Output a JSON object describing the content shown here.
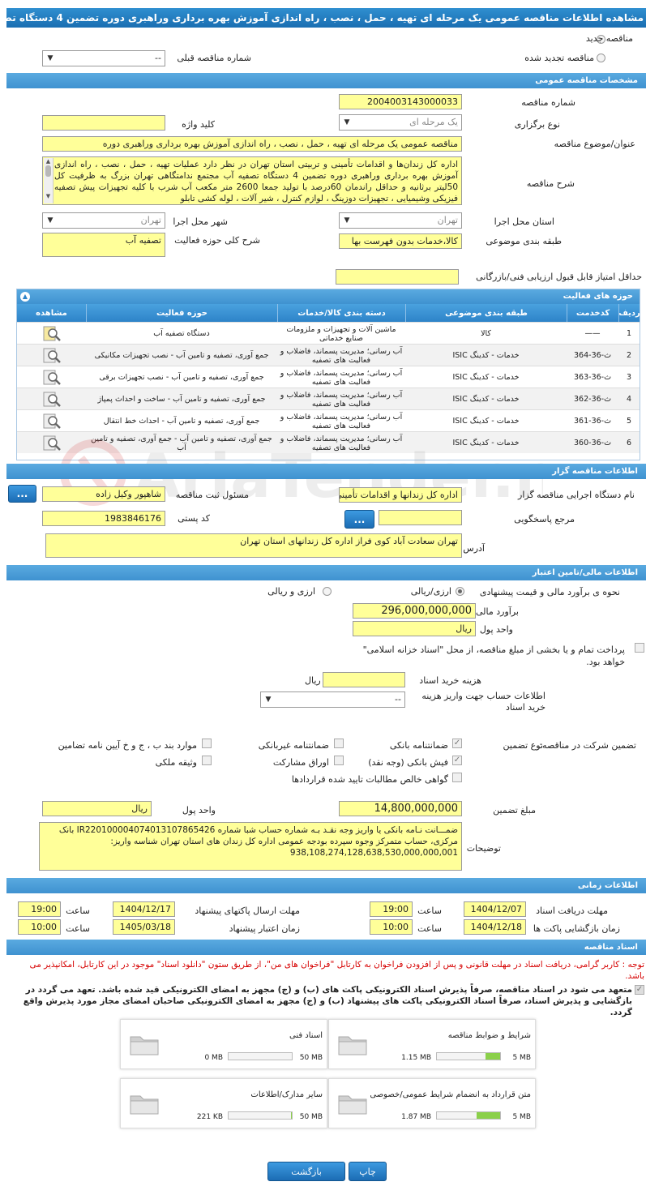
{
  "header": {
    "title": "مشاهده اطلاعات مناقصه عمومی یک مرحله ای تهیه ، حمل ، نصب ، راه اندازی آموزش بهره برداری وراهبری دوره تضمین 4 دستگاه تصفیه آب"
  },
  "top": {
    "new_label": "مناقصه جدید",
    "renew_label": "مناقصه تجدید شده",
    "prev_label": "شماره مناقصه قبلی",
    "prev_value": "--"
  },
  "general": {
    "title": "مشخصات مناقصه عمومی",
    "number_label": "شماره مناقصه",
    "number_value": "2004003143000033",
    "type_label": "نوع برگزاری",
    "type_value": "یک مرحله ای",
    "keyword_label": "کلید واژه",
    "keyword_value": "",
    "subject_label": "عنوان/موضوع مناقصه",
    "subject_value": "مناقصه عمومی یک مرحله ای تهیه ، حمل ، نصب ، راه اندازی آموزش بهره برداری وراهبری دوره",
    "desc_label": "شرح مناقصه",
    "desc_value": "اداره کل زندان‌ها و اقدامات تأمینی و تربیتی استان تهران در نظر دارد عملیات تهیه ، حمل ، نصب ، راه اندازی آموزش بهره برداری وراهبری دوره تضمین 4 دستگاه تصفیه آب مجتمع ندامتگاهی تهران بزرگ به ظرفیت کل 50لیتر برثانیه و حداقل راندمان 60درصد با تولید جمعا 2600 متر مکعب آب شرب با کلیه تجهیزات پیش تصفیه فیزیکی وشیمیایی ، تجهیزات دوزینگ ، لوازم کنترل ، شیر آلات ، لوله کشی تابلو",
    "province_label": "استان محل اجرا",
    "province_value": "تهران",
    "city_label": "شهر محل اجرا",
    "city_value": "تهران",
    "category_label": "طبقه بندی موضوعی",
    "category_value": "کالا،خدمات بدون فهرست بها",
    "activity_label": "شرح کلی حوزه فعالیت",
    "activity_value": "تصفیه آب",
    "minscore_label": "حداقل امتیاز قابل قبول ارزیابی فنی/بازرگانی",
    "minscore_value": ""
  },
  "activities": {
    "title": "حوزه های فعالیت",
    "columns": [
      "ردیف",
      "کدخدمت",
      "طبقه بندی موضوعی",
      "دسته بندی کالا/خدمات",
      "حوزه فعالیت",
      "مشاهده"
    ],
    "rows": [
      {
        "n": "1",
        "code": "——",
        "cat": "کالا",
        "group": "ماشین آلات و تجهیزات و ملزومات صنایع خدماتی",
        "field": "دستگاه تصفیه آب"
      },
      {
        "n": "2",
        "code": "ث-36-364",
        "cat": "خدمات - کدینگ ISIC",
        "group": "آب رسانی؛ مدیریت پسماند، فاضلاب و فعالیت های تصفیه",
        "field": "جمع آوری، تصفیه و تامین آب - نصب تجهیزات مکانیکی"
      },
      {
        "n": "3",
        "code": "ث-36-363",
        "cat": "خدمات - کدینگ ISIC",
        "group": "آب رسانی؛ مدیریت پسماند، فاضلاب و فعالیت های تصفیه",
        "field": "جمع آوری، تصفیه و تامین آب - نصب تجهیزات برقی"
      },
      {
        "n": "4",
        "code": "ث-36-362",
        "cat": "خدمات - کدینگ ISIC",
        "group": "آب رسانی؛ مدیریت پسماند، فاضلاب و فعالیت های تصفیه",
        "field": "جمع آوری، تصفیه و تامین آب - ساخت و احداث پمپاژ"
      },
      {
        "n": "5",
        "code": "ث-36-361",
        "cat": "خدمات - کدینگ ISIC",
        "group": "آب رسانی؛ مدیریت پسماند، فاضلاب و فعالیت های تصفیه",
        "field": "جمع آوری، تصفیه و تامین آب - احداث خط انتقال"
      },
      {
        "n": "6",
        "code": "ث-36-360",
        "cat": "خدمات - کدینگ ISIC",
        "group": "آب رسانی؛ مدیریت پسماند، فاضلاب و فعالیت های تصفیه",
        "field": "جمع آوری، تصفیه و تامین آب - جمع آوری، تصفیه و تامین آب"
      }
    ]
  },
  "organizer": {
    "title": "اطلاعات مناقصه گزار",
    "org_label": "نام دستگاه اجرایی مناقصه گزار",
    "org_value": "اداره کل زندانها و اقدامات تأمینی",
    "resp_label": "مسئول ثبت مناقصه",
    "resp_value": "شاهپور وکیل زاده",
    "dots": "...",
    "ref_label": "مرجع پاسخگویی",
    "ref_value": "",
    "postal_label": "کد پستی",
    "postal_value": "1983846176",
    "address_label": "آدرس",
    "address_value": "تهران سعادت آباد کوی فراز اداره کل زندانهای استان تهران"
  },
  "finance": {
    "title": "اطلاعات مالی/تامین اعتبار",
    "method_label": "نحوه ی برآورد مالی و قیمت پیشنهادی",
    "opt1": "ارزی/ریالی",
    "opt2": "ارزی و ریالی",
    "estimate_label": "برآورد مالی",
    "estimate_value": "296,000,000,000",
    "unit_label": "واحد پول",
    "unit_value": "ریال",
    "treasury_text": "پرداخت تمام و یا بخشی از مبلغ مناقصه، از محل \"اسناد خزانه اسلامی\" خواهد بود.",
    "doccost_label": "هزینه خرید اسناد",
    "doccost_value": "",
    "doccost_unit": "ریال",
    "account_label": "اطلاعات حساب جهت واریز هزینه خرید اسناد",
    "account_value": "--"
  },
  "guarantee": {
    "label": "تضمین شرکت در مناقصه:",
    "type_label": "نوع تضمین",
    "items": [
      "ضمانتنامه بانکی",
      "ضمانتنامه غیربانکی",
      "موارد بند ب ، ج و خ آیین نامه تضامین",
      "فیش بانکی (وجه نقد)",
      "اوراق مشارکت",
      "وثیقه ملکی",
      "گواهی خالص مطالبات تایید شده قراردادها"
    ],
    "amount_label": "مبلغ تضمین",
    "amount_value": "14,800,000,000",
    "unit_label": "واحد پول",
    "unit_value": "ریال",
    "desc_label": "توضیحات",
    "desc_value": "ضمـــانت نـامه بانکی یا واریز وجه نقـد بـه شماره حساب شبا شماره IR220100004074013107865426 بانک مرکزی، حساب متمرکز وجوه سپرده بودجه عمومی اداره کل زندان های استان تهران شناسه واریز: 938,108,274,128,638,530,000,000,001"
  },
  "timing": {
    "title": "اطلاعات زمانی",
    "receive_label": "مهلت دریافت اسناد",
    "receive_date": "1404/12/07",
    "receive_time": "19:00",
    "send_label": "مهلت ارسال پاکتهای پیشنهاد",
    "send_date": "1404/12/17",
    "send_time": "19:00",
    "open_label": "زمان بازگشایی پاکت ها",
    "open_date": "1404/12/18",
    "open_time": "10:00",
    "valid_label": "زمان اعتبار پیشنهاد",
    "valid_date": "1405/03/18",
    "valid_time": "10:00",
    "time_label": "ساعت"
  },
  "docs": {
    "title": "اسناد مناقصه",
    "note": "توجه : کاربر گرامی، دریافت اسناد در مهلت قانونی و پس از افزودن فراخوان به کارتابل \"فراخوان های من\"، از طریق ستون \"دانلود اسناد\" موجود در این کارتابل، امکانپذیر می باشد.",
    "commit": "متعهد می شود در اسناد مناقصه، صرفاً پذیرش اسناد الکترونیکی پاکت های (ب) و (ج) مجهز به امضای الکترونیکی قید شده باشد. تعهد می گردد در بازگشایی و پذیرش اسناد، صرفاً اسناد الکترونیکی پاکت های پیشنهاد (ب) و (ج) مجهز به امضای الکترونیکی صاحبان امضای مجاز مورد پذیرش واقع گردد.",
    "files": [
      {
        "name": "شرایط و ضوابط مناقصه",
        "used": "1.15 MB",
        "max": "5 MB",
        "fill": 0.23
      },
      {
        "name": "اسناد فنی",
        "used": "0 MB",
        "max": "50 MB",
        "fill": 0
      },
      {
        "name": "متن قرارداد به انضمام شرایط عمومی/خصوصی",
        "used": "1.87 MB",
        "max": "5 MB",
        "fill": 0.37
      },
      {
        "name": "سایر مدارک/اطلاعات",
        "used": "221 KB",
        "max": "50 MB",
        "fill": 0.005
      }
    ]
  },
  "buttons": {
    "back": "بازگشت",
    "print": "چاپ"
  },
  "colors": {
    "header": "#1a6eb1",
    "field": "#ffff99",
    "accent": "#8bd04a",
    "warn": "#d60000"
  }
}
